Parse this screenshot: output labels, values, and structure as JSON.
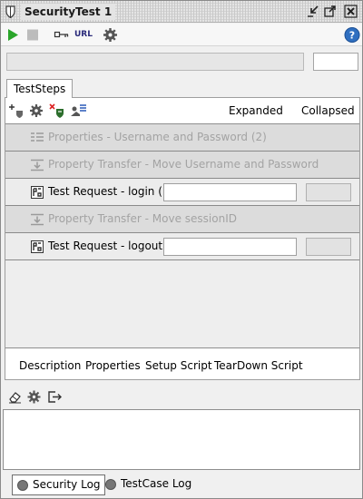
{
  "window": {
    "title": "SecurityTest 1"
  },
  "progress": {
    "fraction": 0.0,
    "value": ""
  },
  "tabs": {
    "teststeps": "TestSteps"
  },
  "steps_toolbar": {
    "expanded": "Expanded",
    "collapsed": "Collapsed"
  },
  "toolbar": {
    "url_label": "URL"
  },
  "steps": [
    {
      "label": "Properties - Username and Password (2)",
      "icon": "properties-icon",
      "enabled": false
    },
    {
      "label": "Property Transfer - Move Username and Password",
      "icon": "property-transfer-icon",
      "enabled": false
    },
    {
      "label": "Test Request - login (",
      "icon": "test-request-icon",
      "enabled": true,
      "input": ""
    },
    {
      "label": "Property Transfer - Move sessionID",
      "icon": "property-transfer-icon",
      "enabled": false
    },
    {
      "label": "Test Request - logout",
      "icon": "test-request-icon",
      "enabled": true,
      "input": ""
    }
  ],
  "bottom_tabs": [
    "Description",
    "Properties",
    "Setup Script",
    "TearDown Script"
  ],
  "log_tabs": [
    "Security Log",
    "TestCase Log"
  ],
  "colors": {
    "run": "#2aa52a",
    "disabled_text": "#a3a3a3",
    "accent_help": "#2f6fc0"
  }
}
